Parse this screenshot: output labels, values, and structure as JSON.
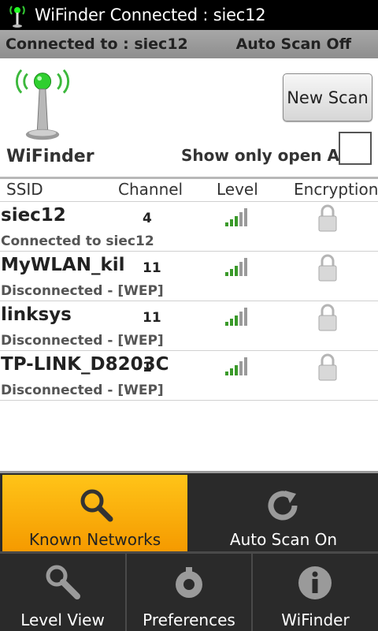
{
  "statusbar": {
    "title": "WiFinder Connected : siec12",
    "icon": "wifi-tower-icon"
  },
  "connbar": {
    "connected": "Connected to : siec12",
    "autoscan": "Auto Scan Off"
  },
  "header": {
    "app_name": "WiFinder",
    "new_scan_label": "New Scan",
    "show_open_label": "Show only open Ap",
    "show_open_checked": false
  },
  "columns": {
    "ssid": "SSID",
    "channel": "Channel",
    "level": "Level",
    "encryption": "Encryption"
  },
  "networks": [
    {
      "ssid": "siec12",
      "channel": "4",
      "status": "Connected to siec12",
      "level_bars": 5,
      "encrypted": true
    },
    {
      "ssid": "MyWLAN_kil",
      "channel": "11",
      "status": "Disconnected - [WEP]",
      "level_bars": 5,
      "encrypted": true
    },
    {
      "ssid": "linksys",
      "channel": "11",
      "status": "Disconnected - [WEP]",
      "level_bars": 5,
      "encrypted": true
    },
    {
      "ssid": "TP-LINK_D8203C",
      "channel": "1",
      "status": "Disconnected - [WEP]",
      "level_bars": 5,
      "encrypted": true
    }
  ],
  "menu": {
    "known_networks": "Known Networks",
    "auto_scan_on": "Auto Scan On",
    "level_view": "Level View",
    "preferences": "Preferences",
    "wifinder": "WiFinder"
  },
  "colors": {
    "accent": "#f7a800",
    "signal": "#3a9a2a"
  }
}
